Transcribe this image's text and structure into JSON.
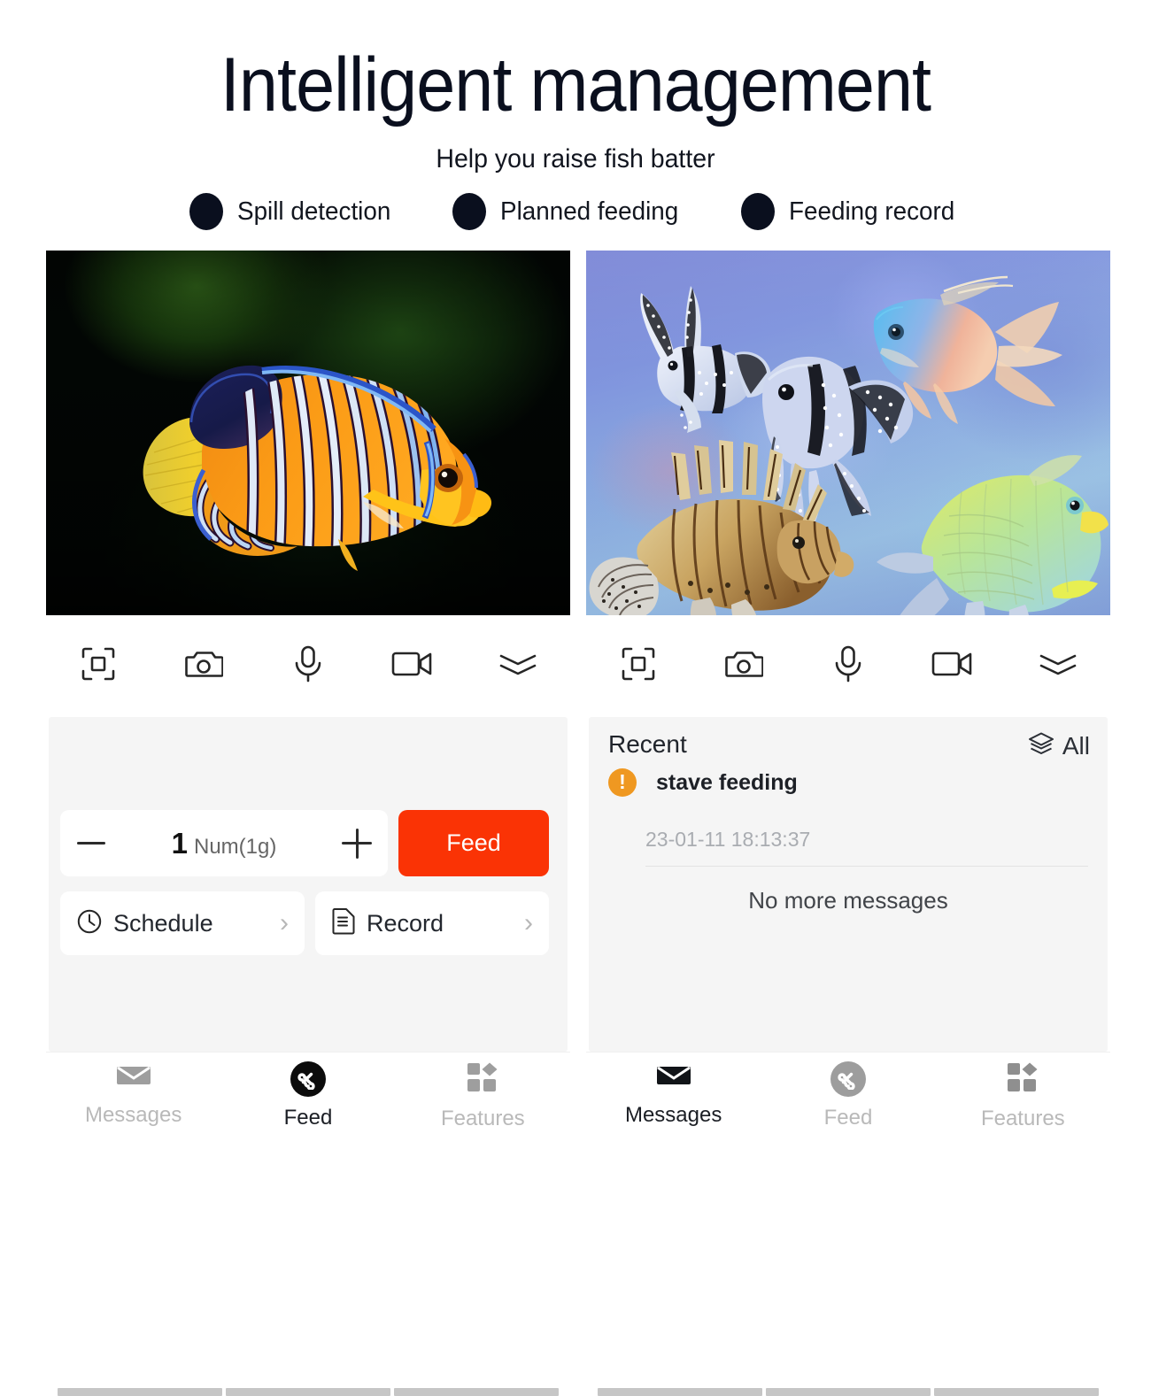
{
  "header": {
    "title": "Intelligent management",
    "subtitle": "Help you raise fish batter",
    "features": [
      {
        "label": "Spill detection"
      },
      {
        "label": "Planned feeding"
      },
      {
        "label": "Feeding record"
      }
    ],
    "bullet_color": "#0a0f1e"
  },
  "toolbar": {
    "icons": [
      {
        "name": "fullscreen-icon"
      },
      {
        "name": "camera-icon"
      },
      {
        "name": "microphone-icon"
      },
      {
        "name": "video-camera-icon"
      },
      {
        "name": "double-chevron-down-icon"
      }
    ]
  },
  "left_phone": {
    "viewport_alt": "Regal angelfish swimming in dark green aquarium",
    "feed_card": {
      "decrement_label": "−",
      "increment_label": "+",
      "value": "1",
      "unit": "Num(1g)",
      "feed_button": "Feed"
    },
    "rows": [
      {
        "label": "Schedule",
        "icon": "clock-icon",
        "chevron": "›"
      },
      {
        "label": "Record",
        "icon": "document-icon",
        "chevron": "›"
      }
    ],
    "nav": [
      {
        "label": "Messages",
        "icon": "envelope-icon",
        "active": false
      },
      {
        "label": "Feed",
        "icon": "bone-icon",
        "active": true
      },
      {
        "label": "Features",
        "icon": "grid-icon",
        "active": false
      }
    ]
  },
  "right_phone": {
    "viewport_alt": "Five tropical fish swimming in blue water",
    "recent": {
      "title": "Recent",
      "all_label": "All",
      "all_icon": "layers-icon",
      "message": {
        "status_icon": "warning-icon",
        "status_color": "#ef9821",
        "text": "stave feeding",
        "timestamp": "23-01-11 18:13:37"
      },
      "empty_text": "No more messages"
    },
    "nav": [
      {
        "label": "Messages",
        "icon": "envelope-icon",
        "active": true
      },
      {
        "label": "Feed",
        "icon": "bone-icon",
        "active": false
      },
      {
        "label": "Features",
        "icon": "grid-icon",
        "active": false
      }
    ]
  },
  "colors": {
    "accent_red": "#fa3305",
    "panel_bg": "#f5f5f5",
    "warning": "#ef9821"
  }
}
